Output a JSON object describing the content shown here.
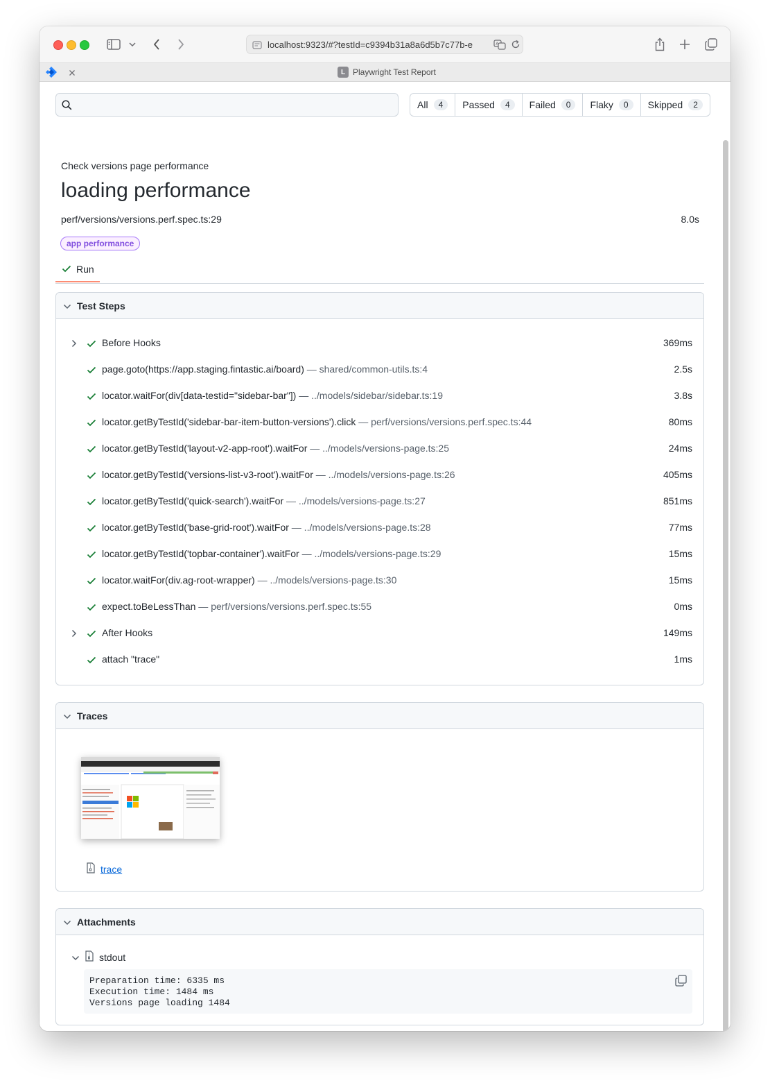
{
  "browser": {
    "url": "localhost:9323/#?testId=c9394b31a8a6d5b7c77b-e",
    "tab_title": "Playwright Test Report",
    "favicon_letter": "L"
  },
  "report": {
    "search": {
      "placeholder": "",
      "value": ""
    },
    "filters": [
      {
        "label": "All",
        "count": "4"
      },
      {
        "label": "Passed",
        "count": "4"
      },
      {
        "label": "Failed",
        "count": "0"
      },
      {
        "label": "Flaky",
        "count": "0"
      },
      {
        "label": "Skipped",
        "count": "2"
      }
    ],
    "suite": "Check versions page performance",
    "title": "loading performance",
    "location": "perf/versions/versions.perf.spec.ts:29",
    "duration": "8.0s",
    "tag": "app performance",
    "run_tab": "Run"
  },
  "steps_section": {
    "title": "Test Steps",
    "steps": [
      {
        "title": "Before Hooks",
        "loc": "",
        "dur": "369ms",
        "expandable": true
      },
      {
        "title": "page.goto(https://app.staging.fintastic.ai/board)",
        "loc": " — shared/common-utils.ts:4",
        "dur": "2.5s",
        "expandable": false
      },
      {
        "title": "locator.waitFor(div[data-testid=\"sidebar-bar\"])",
        "loc": " — ../models/sidebar/sidebar.ts:19",
        "dur": "3.8s",
        "expandable": false
      },
      {
        "title": "locator.getByTestId('sidebar-bar-item-button-versions').click",
        "loc": " — perf/versions/versions.perf.spec.ts:44",
        "dur": "80ms",
        "expandable": false
      },
      {
        "title": "locator.getByTestId('layout-v2-app-root').waitFor",
        "loc": " — ../models/versions-page.ts:25",
        "dur": "24ms",
        "expandable": false
      },
      {
        "title": "locator.getByTestId('versions-list-v3-root').waitFor",
        "loc": " — ../models/versions-page.ts:26",
        "dur": "405ms",
        "expandable": false
      },
      {
        "title": "locator.getByTestId('quick-search').waitFor",
        "loc": " — ../models/versions-page.ts:27",
        "dur": "851ms",
        "expandable": false
      },
      {
        "title": "locator.getByTestId('base-grid-root').waitFor",
        "loc": " — ../models/versions-page.ts:28",
        "dur": "77ms",
        "expandable": false
      },
      {
        "title": "locator.getByTestId('topbar-container').waitFor",
        "loc": " — ../models/versions-page.ts:29",
        "dur": "15ms",
        "expandable": false
      },
      {
        "title": "locator.waitFor(div.ag-root-wrapper)",
        "loc": " — ../models/versions-page.ts:30",
        "dur": "15ms",
        "expandable": false
      },
      {
        "title": "expect.toBeLessThan",
        "loc": " — perf/versions/versions.perf.spec.ts:55",
        "dur": "0ms",
        "expandable": false
      },
      {
        "title": "After Hooks",
        "loc": "",
        "dur": "149ms",
        "expandable": true
      },
      {
        "title": "attach \"trace\"",
        "loc": "",
        "dur": "1ms",
        "expandable": false
      }
    ]
  },
  "traces_section": {
    "title": "Traces",
    "link": "trace"
  },
  "attachments_section": {
    "title": "Attachments",
    "item": "stdout",
    "output": "Preparation time: 6335 ms\nExecution time: 1484 ms\nVersions page loading 1484"
  },
  "colors": {
    "pass_green": "#1a7f37",
    "tag_purple": "#8250df",
    "link_blue": "#0969da",
    "tab_underline": "#fd8c73"
  }
}
